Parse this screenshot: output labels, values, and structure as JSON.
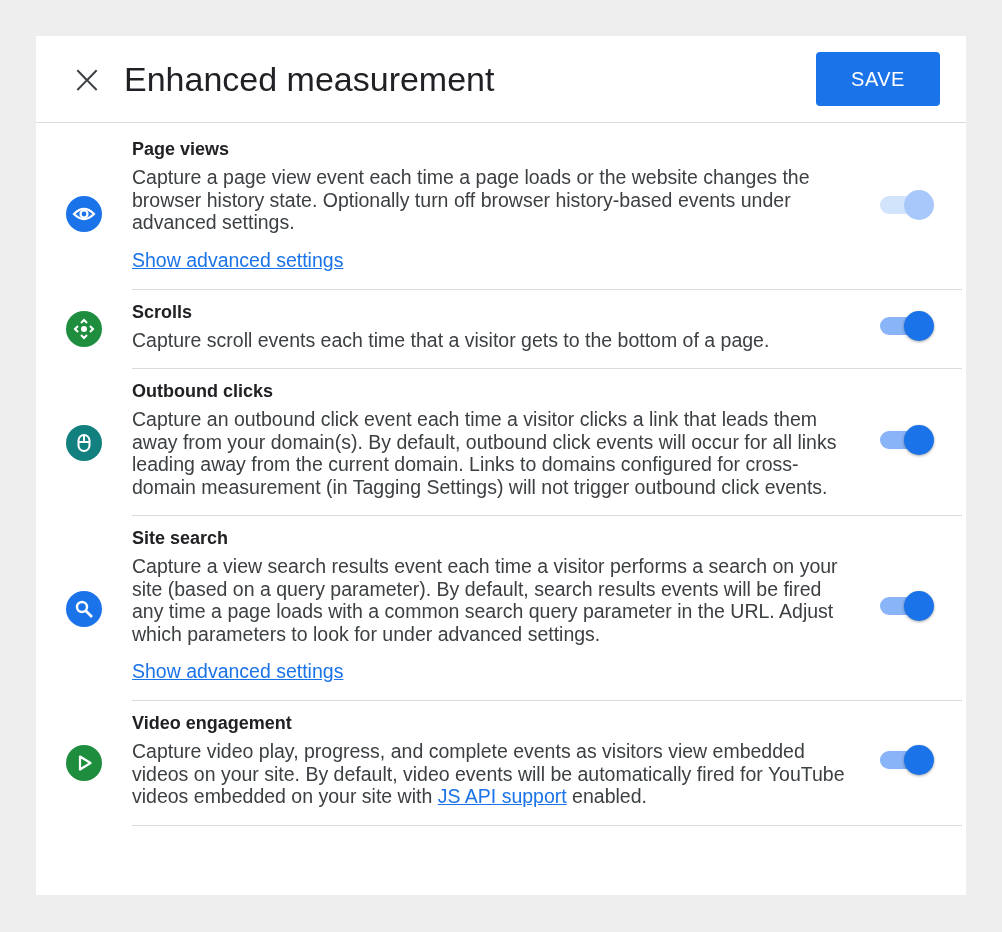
{
  "header": {
    "close": "×",
    "title": "Enhanced measurement",
    "save_button": "SAVE"
  },
  "settings": [
    {
      "kind": "eye",
      "color": "#1a73e8",
      "title": "Page views",
      "description": "Capture a page view event each time a page loads or the website changes the browser history state. Optionally turn off browser history-based events under advanced settings.",
      "advanced_link": "Show advanced settings",
      "on": true,
      "disabled": true
    },
    {
      "kind": "scroll",
      "color": "#1e8e3e",
      "title": "Scrolls",
      "description": "Capture scroll events each time that a visitor gets to the bottom of a page.",
      "on": true,
      "disabled": false
    },
    {
      "kind": "mouse",
      "color": "#12807f",
      "title": "Outbound clicks",
      "description": "Capture an outbound click event each time a visitor clicks a link that leads them away from your domain(s). By default, outbound click events will occur for all links leading away from the current domain. Links to domains configured for cross-domain measurement (in Tagging Settings) will not trigger outbound click events.",
      "on": true,
      "disabled": false
    },
    {
      "kind": "search",
      "color": "#1a73e8",
      "title": "Site search",
      "description": "Capture a view search results event each time a visitor performs a search on your site (based on a query parameter). By default, search results events will be fired any time a page loads with a common search query parameter in the URL. Adjust which parameters to look for under advanced settings.",
      "advanced_link": "Show advanced settings",
      "on": true,
      "disabled": false
    },
    {
      "kind": "play",
      "color": "#1e8e3e",
      "title": "Video engagement",
      "description": "Capture video play, progress, and complete events as visitors view embedded videos on your site. By default, video events will be automatically fired for YouTube videos embedded on your site with ",
      "inline_link": "JS API support",
      "description_after": " enabled.",
      "on": true,
      "disabled": false
    }
  ]
}
